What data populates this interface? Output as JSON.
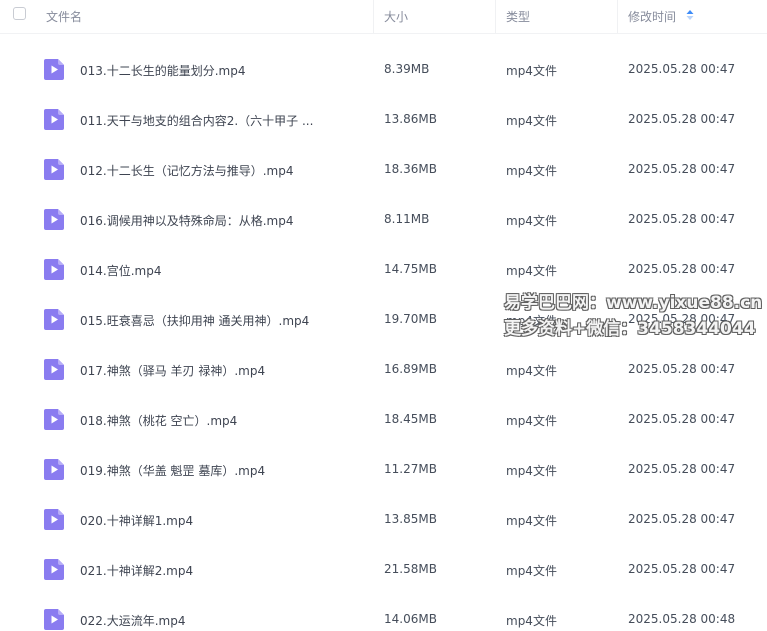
{
  "header": {
    "name_label": "文件名",
    "size_label": "大小",
    "type_label": "类型",
    "time_label": "修改时间"
  },
  "colors": {
    "icon_purple": "#8a7cf0",
    "accent_blue": "#3e8cf7"
  },
  "rows": [
    {
      "name": "013.十二长生的能量划分.mp4",
      "size": "8.39MB",
      "type": "mp4文件",
      "time": "2025.05.28 00:47"
    },
    {
      "name": "011.天干与地支的组合内容2.（六十甲子 ...",
      "size": "13.86MB",
      "type": "mp4文件",
      "time": "2025.05.28 00:47"
    },
    {
      "name": "012.十二长生（记忆方法与推导）.mp4",
      "size": "18.36MB",
      "type": "mp4文件",
      "time": "2025.05.28 00:47"
    },
    {
      "name": "016.调候用神以及特殊命局：从格.mp4",
      "size": "8.11MB",
      "type": "mp4文件",
      "time": "2025.05.28 00:47"
    },
    {
      "name": "014.宫位.mp4",
      "size": "14.75MB",
      "type": "mp4文件",
      "time": "2025.05.28 00:47"
    },
    {
      "name": "015.旺衰喜忌（扶抑用神 通关用神）.mp4",
      "size": "19.70MB",
      "type": "mp4文件",
      "time": "2025.05.28 00:47"
    },
    {
      "name": "017.神煞（驿马 羊刃 禄神）.mp4",
      "size": "16.89MB",
      "type": "mp4文件",
      "time": "2025.05.28 00:47"
    },
    {
      "name": "018.神煞（桃花 空亡）.mp4",
      "size": "18.45MB",
      "type": "mp4文件",
      "time": "2025.05.28 00:47"
    },
    {
      "name": "019.神煞（华盖 魁罡 墓库）.mp4",
      "size": "11.27MB",
      "type": "mp4文件",
      "time": "2025.05.28 00:47"
    },
    {
      "name": "020.十神详解1.mp4",
      "size": "13.85MB",
      "type": "mp4文件",
      "time": "2025.05.28 00:47"
    },
    {
      "name": "021.十神详解2.mp4",
      "size": "21.58MB",
      "type": "mp4文件",
      "time": "2025.05.28 00:47"
    },
    {
      "name": "022.大运流年.mp4",
      "size": "14.06MB",
      "type": "mp4文件",
      "time": "2025.05.28 00:48"
    }
  ],
  "watermark": {
    "line1": "易学巴巴网：www.yixue88.cn",
    "line2": "更多资料+微信：3458344044"
  }
}
